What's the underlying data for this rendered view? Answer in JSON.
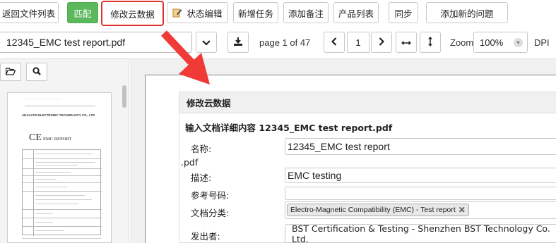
{
  "toolbar": {
    "back_to_list": "返回文件列表",
    "match": "匹配",
    "edit_cloud_data": "修改云数据",
    "status_edit": "状态编辑",
    "new_task": "新增任务",
    "add_note": "添加备注",
    "product_list": "产品列表",
    "sync": "同步",
    "add_issue": "添加新的问题"
  },
  "viewer": {
    "file_name": "12345_EMC test report.pdf",
    "page_info": "page 1 of 47",
    "page_number": "1",
    "zoom_label": "Zoom",
    "zoom_value": "100%",
    "dpi_label": "DPI"
  },
  "thumbnail": {
    "company": "ANALYSIS ELECTRONIC TECHNOLOGY CO., LTD",
    "report_title": "EMC REPORT",
    "ce_mark": "CE"
  },
  "modal": {
    "title": "修改云数据",
    "subtitle": "输入文档详细内容 12345_EMC test report.pdf",
    "fields": {
      "name_label": "名称:",
      "name_value": "12345_EMC test report",
      "name_ext": ".pdf",
      "desc_label": "描述:",
      "desc_value": "EMC testing",
      "ref_label": "参考号码:",
      "ref_value": "",
      "category_label": "文档分类:",
      "category_tag": "Electro-Magnetic Compatibility (EMC) - Test report",
      "issuer_label": "发出者:",
      "issuer_value": "BST Certification & Testing - Shenzhen BST Technology Co. Ltd."
    }
  },
  "colors": {
    "match_green": "#5cb85c",
    "highlight_red": "#e0312f",
    "arrow_red": "#ef3a37"
  }
}
